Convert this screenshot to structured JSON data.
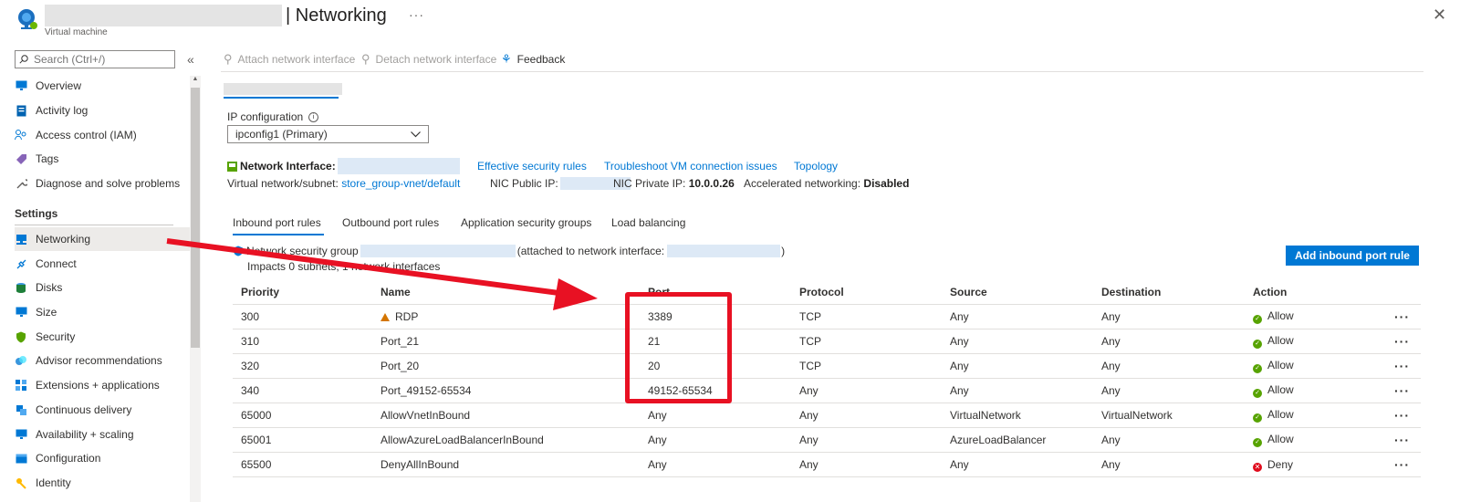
{
  "header": {
    "title": "| Networking",
    "subtitle": "Virtual machine",
    "more": "···",
    "close": "✕"
  },
  "sidebar": {
    "search_placeholder": "Search (Ctrl+/)",
    "collapse": "«",
    "items": [
      {
        "label": "Overview",
        "icon": "monitor-icon"
      },
      {
        "label": "Activity log",
        "icon": "activity-log-icon"
      },
      {
        "label": "Access control (IAM)",
        "icon": "people-icon"
      },
      {
        "label": "Tags",
        "icon": "tag-icon"
      },
      {
        "label": "Diagnose and solve problems",
        "icon": "wrench-icon"
      }
    ],
    "settings_heading": "Settings",
    "settings_items": [
      {
        "label": "Networking",
        "icon": "networking-icon",
        "active": true
      },
      {
        "label": "Connect",
        "icon": "plug-icon"
      },
      {
        "label": "Disks",
        "icon": "disks-icon"
      },
      {
        "label": "Size",
        "icon": "size-icon"
      },
      {
        "label": "Security",
        "icon": "shield-icon"
      },
      {
        "label": "Advisor recommendations",
        "icon": "advisor-icon"
      },
      {
        "label": "Extensions + applications",
        "icon": "extensions-icon"
      },
      {
        "label": "Continuous delivery",
        "icon": "delivery-icon"
      },
      {
        "label": "Availability + scaling",
        "icon": "scaling-icon"
      },
      {
        "label": "Configuration",
        "icon": "config-icon"
      },
      {
        "label": "Identity",
        "icon": "identity-icon"
      }
    ]
  },
  "toolbar": {
    "attach": "Attach network interface",
    "detach": "Detach network interface",
    "feedback": "Feedback"
  },
  "ip_config": {
    "label": "IP configuration",
    "selected": "ipconfig1 (Primary)"
  },
  "nic": {
    "label": "Network Interface:",
    "effective_rules": "Effective security rules",
    "troubleshoot": "Troubleshoot VM connection issues",
    "topology": "Topology",
    "vnet_label": "Virtual network/subnet:",
    "vnet_value": "store_group-vnet/default",
    "public_ip_label": "NIC Public IP:",
    "private_ip_label": "NIC Private IP:",
    "private_ip_value": "10.0.0.26",
    "accel_label": "Accelerated networking:",
    "accel_value": "Disabled"
  },
  "tabs": [
    {
      "label": "Inbound port rules",
      "active": true
    },
    {
      "label": "Outbound port rules"
    },
    {
      "label": "Application security groups"
    },
    {
      "label": "Load balancing"
    }
  ],
  "nsg": {
    "prefix": "Network security group",
    "attached": "(attached to network interface:",
    "suffix": ")",
    "impacts": "Impacts 0 subnets, 1 network interfaces",
    "add_button": "Add inbound port rule"
  },
  "rules_table": {
    "columns": [
      "Priority",
      "Name",
      "Port",
      "Protocol",
      "Source",
      "Destination",
      "Action"
    ],
    "rows": [
      {
        "priority": "300",
        "name": "RDP",
        "warn": true,
        "port": "3389",
        "protocol": "TCP",
        "source": "Any",
        "destination": "Any",
        "action": "Allow"
      },
      {
        "priority": "310",
        "name": "Port_21",
        "port": "21",
        "protocol": "TCP",
        "source": "Any",
        "destination": "Any",
        "action": "Allow"
      },
      {
        "priority": "320",
        "name": "Port_20",
        "port": "20",
        "protocol": "TCP",
        "source": "Any",
        "destination": "Any",
        "action": "Allow"
      },
      {
        "priority": "340",
        "name": "Port_49152-65534",
        "port": "49152-65534",
        "protocol": "Any",
        "source": "Any",
        "destination": "Any",
        "action": "Allow"
      },
      {
        "priority": "65000",
        "name": "AllowVnetInBound",
        "port": "Any",
        "protocol": "Any",
        "source": "VirtualNetwork",
        "destination": "VirtualNetwork",
        "action": "Allow"
      },
      {
        "priority": "65001",
        "name": "AllowAzureLoadBalancerInBound",
        "port": "Any",
        "protocol": "Any",
        "source": "AzureLoadBalancer",
        "destination": "Any",
        "action": "Allow"
      },
      {
        "priority": "65500",
        "name": "DenyAllInBound",
        "port": "Any",
        "protocol": "Any",
        "source": "Any",
        "destination": "Any",
        "action": "Deny"
      }
    ],
    "row_menu": "···"
  },
  "colors": {
    "accent": "#0078d4",
    "annotation_red": "#e81123",
    "allow_green": "#57a300",
    "deny_red": "#e00b1c",
    "warning_orange": "#d47500"
  }
}
